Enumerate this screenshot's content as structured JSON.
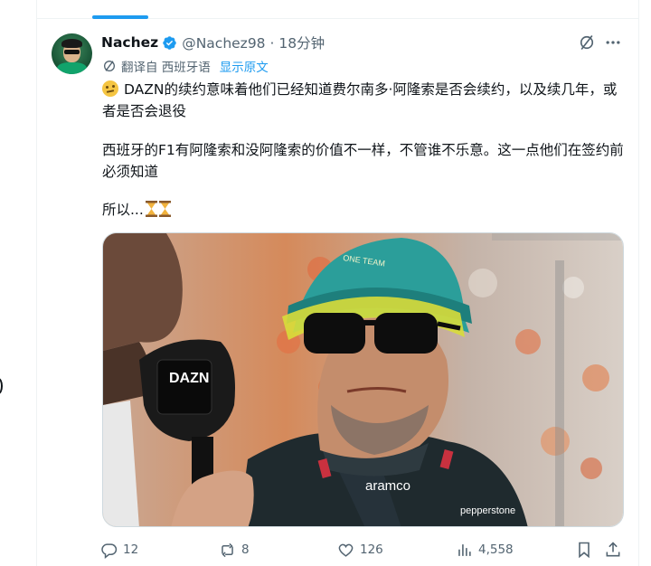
{
  "tweet": {
    "display_name": "Nachez",
    "handle": "@Nachez98",
    "separator": "·",
    "time": "18分钟",
    "translated_from": "翻译自 西班牙语",
    "show_original": "显示原文",
    "paragraph1": "DAZN的续约意味着他们已经知道费尔南多·阿隆索是否会续约，以及续几年，或者是否会退役",
    "paragraph2": "西班牙的F1有阿隆索和没阿隆索的价值不一样，不管谁不乐意。这一点他们在签约前必须知道",
    "paragraph3": "所以...",
    "image_caption_marks": {
      "mic_brand": "DAZN",
      "shirt_sponsor": "aramco",
      "sponsor_right": "pepperstone",
      "cap_text": "ONE TEAM"
    }
  },
  "actions": {
    "replies": "12",
    "reposts": "8",
    "likes": "126",
    "views": "4,558"
  },
  "icons": {
    "verified": "verified-badge-icon",
    "grok": "grok-icon",
    "more": "more-icon",
    "translate": "translate-icon",
    "reply": "reply-icon",
    "repost": "repost-icon",
    "like": "like-icon",
    "views": "views-icon",
    "bookmark": "bookmark-icon",
    "share": "share-icon"
  },
  "colors": {
    "accent": "#1d9bf0",
    "text": "#0f1419",
    "muted": "#536471"
  }
}
